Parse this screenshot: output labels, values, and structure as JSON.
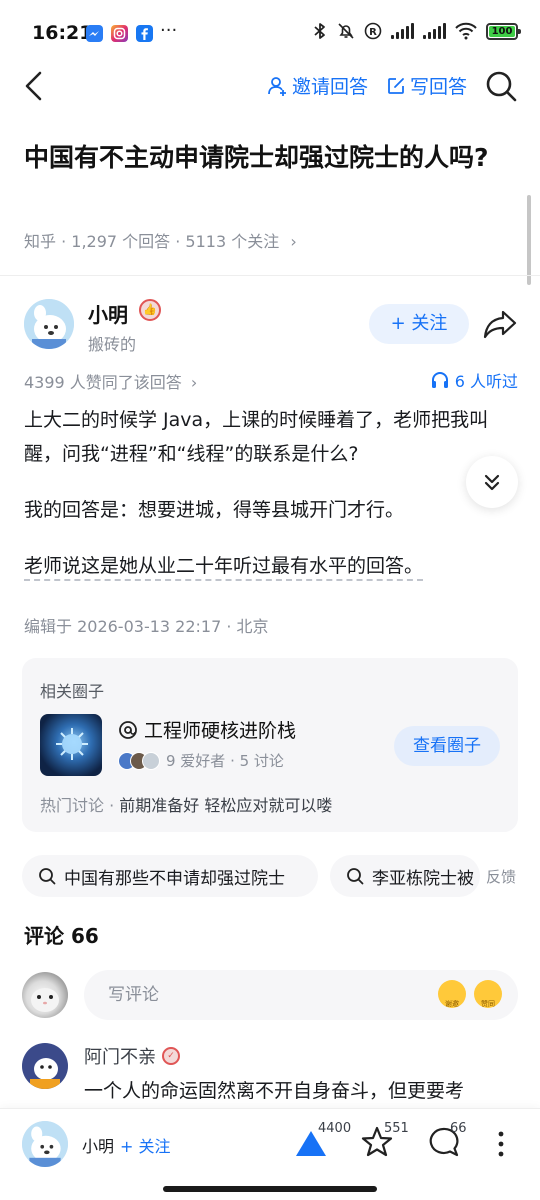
{
  "status_bar": {
    "time": "16:21",
    "dots": "···",
    "battery": "100",
    "app_icons": [
      "messenger-icon",
      "instagram-icon",
      "facebook-icon"
    ],
    "right_icons": [
      "bluetooth-icon",
      "mute-icon",
      "r-icon",
      "signal-icon",
      "signal-icon",
      "wifi-icon",
      "battery-icon"
    ]
  },
  "nav": {
    "invite_label": "邀请回答",
    "write_label": "写回答"
  },
  "question": {
    "title": "中国有不主动申请院士却强过院士的人吗?",
    "meta": "知乎 · 1,297 个回答 · 5113 个关注",
    "meta_chevron": "›"
  },
  "author": {
    "name": "小明",
    "bio": "搬砖的",
    "follow_label": "+ 关注"
  },
  "stats": {
    "votes": "4399 人赞同了该回答",
    "votes_chevron": "›",
    "listen": "6 人听过"
  },
  "answer": {
    "p1": "上大二的时候学 Java，上课的时候睡着了，老师把我叫醒，问我“进程”和“线程”的联系是什么?",
    "p2": "我的回答是：想要进城，得等县城开门才行。",
    "p3": "老师说这是她从业二十年听过最有水平的回答。",
    "edited": "编辑于 2026-03-13 22:17 · 北京"
  },
  "circle_card": {
    "title": "相关圈子",
    "name": "工程师硬核进阶栈",
    "stats": "9 爱好者 · 5 讨论",
    "button": "查看圈子",
    "hot_prefix": "热门讨论 · ",
    "hot_text": "前期准备好 轻松应对就可以喽"
  },
  "related": {
    "chip1": "中国有那些不申请却强过院士",
    "chip2": "李亚栋院士被",
    "feedback": "反馈"
  },
  "comments": {
    "header": "评论 66",
    "placeholder": "写评论",
    "emoji1": "谢邀",
    "emoji2": "赞同",
    "first": {
      "name": "阿门不亲",
      "text": "一个人的命运固然离不开自身奋斗，但更要考"
    }
  },
  "bottom_bar": {
    "name": "小明",
    "follow": "+ 关注",
    "upvotes": "4400",
    "favorites": "551",
    "comments": "66"
  },
  "colors": {
    "accent": "#1772f6",
    "text": "#191b1f",
    "muted": "#8a8f99",
    "card_bg": "#f6f6f8"
  }
}
